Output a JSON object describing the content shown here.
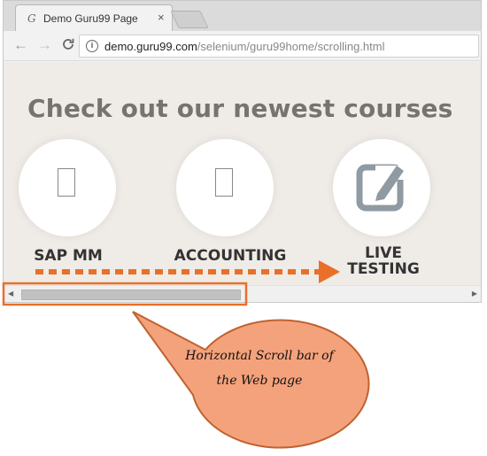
{
  "browser": {
    "tab": {
      "title": "Demo Guru99 Page",
      "favicon": "G",
      "close": "×"
    },
    "nav": {
      "back": "←",
      "forward": "→",
      "reload": "C"
    },
    "address": {
      "domain": "demo.guru99.com",
      "path": "/selenium/guru99home/scrolling.html"
    }
  },
  "page": {
    "heading": "Check out our newest courses",
    "courses": [
      {
        "label": "SAP MM",
        "icon": "blank-page-icon"
      },
      {
        "label": "ACCOUNTING",
        "icon": "blank-page-icon"
      },
      {
        "label": "LIVE\nTESTING",
        "icon": "edit-icon"
      }
    ]
  },
  "scrollbar": {
    "left_arrow": "◀",
    "right_arrow": "▶"
  },
  "annotation": {
    "callout_text": "Horizontal Scroll bar of the Web page",
    "colors": {
      "highlight": "#e8702a",
      "callout_fill": "#f4a27b",
      "arrow": "#e8702a"
    }
  }
}
